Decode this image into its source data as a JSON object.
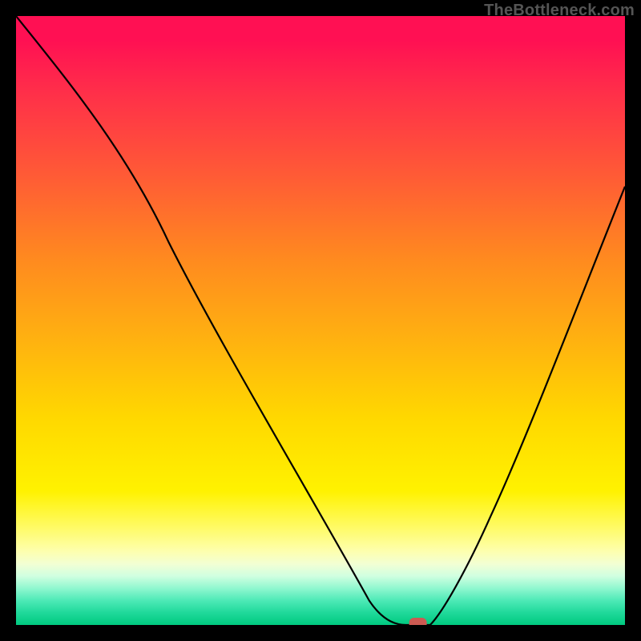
{
  "watermark": "TheBottleneck.com",
  "chart_data": {
    "type": "line",
    "title": "",
    "xlabel": "",
    "ylabel": "",
    "categories": [
      0,
      5,
      10,
      15,
      20,
      25,
      30,
      35,
      40,
      45,
      50,
      55,
      58,
      62,
      65,
      68,
      70,
      75,
      80,
      85,
      90,
      95,
      100
    ],
    "series": [
      {
        "name": "bottleneck-curve",
        "values": [
          100,
          93,
          86,
          79,
          72,
          63,
          55,
          46,
          37,
          28,
          19,
          10,
          4,
          0,
          0,
          0,
          4,
          12,
          22,
          33,
          45,
          58,
          72
        ]
      }
    ],
    "xlim": [
      0,
      100
    ],
    "ylim": [
      0,
      100
    ],
    "marker": {
      "x": 66,
      "y": 0,
      "color": "#cc5a52"
    },
    "gradient_stops": [
      {
        "pos": 0.0,
        "color": "#ff1053"
      },
      {
        "pos": 0.04,
        "color": "#ff1053"
      },
      {
        "pos": 0.12,
        "color": "#ff2d4a"
      },
      {
        "pos": 0.26,
        "color": "#ff5a36"
      },
      {
        "pos": 0.4,
        "color": "#ff8a1f"
      },
      {
        "pos": 0.54,
        "color": "#ffb40f"
      },
      {
        "pos": 0.66,
        "color": "#ffd800"
      },
      {
        "pos": 0.78,
        "color": "#fff200"
      },
      {
        "pos": 0.84,
        "color": "#fffb66"
      },
      {
        "pos": 0.88,
        "color": "#fdffb0"
      },
      {
        "pos": 0.9,
        "color": "#f2ffd4"
      },
      {
        "pos": 0.92,
        "color": "#cfffe0"
      },
      {
        "pos": 0.94,
        "color": "#8ff7cf"
      },
      {
        "pos": 0.96,
        "color": "#4de9b6"
      },
      {
        "pos": 0.98,
        "color": "#1fd99a"
      },
      {
        "pos": 1.0,
        "color": "#00c97f"
      }
    ]
  }
}
